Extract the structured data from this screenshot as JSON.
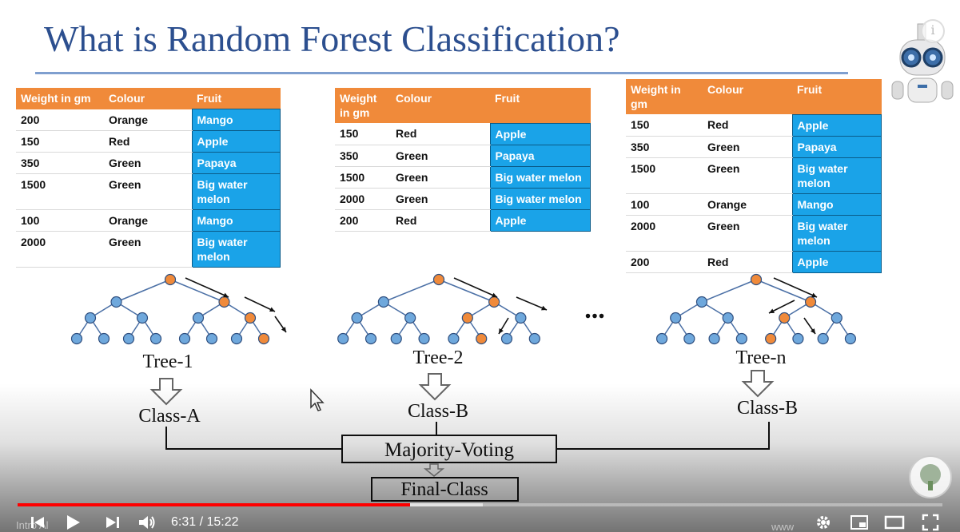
{
  "slide": {
    "title": "What is Random Forest Classification?",
    "tables": [
      {
        "headers": [
          "Weight in gm",
          "Colour",
          "Fruit"
        ],
        "rows": [
          [
            "200",
            "Orange",
            "Mango"
          ],
          [
            "150",
            "Red",
            "Apple"
          ],
          [
            "350",
            "Green",
            "Papaya"
          ],
          [
            "1500",
            "Green",
            "Big water melon"
          ],
          [
            "100",
            "Orange",
            "Mango"
          ],
          [
            "2000",
            "Green",
            "Big water melon"
          ]
        ]
      },
      {
        "headers": [
          "Weight in gm",
          "Colour",
          "Fruit"
        ],
        "rows": [
          [
            "150",
            "Red",
            "Apple"
          ],
          [
            "350",
            "Green",
            "Papaya"
          ],
          [
            "1500",
            "Green",
            "Big water melon"
          ],
          [
            "2000",
            "Green",
            "Big water melon"
          ],
          [
            "200",
            "Red",
            "Apple"
          ]
        ]
      },
      {
        "headers": [
          "Weight in gm",
          "Colour",
          "Fruit"
        ],
        "rows": [
          [
            "150",
            "Red",
            "Apple"
          ],
          [
            "350",
            "Green",
            "Papaya"
          ],
          [
            "1500",
            "Green",
            "Big water melon"
          ],
          [
            "100",
            "Orange",
            "Mango"
          ],
          [
            "2000",
            "Green",
            "Big water melon"
          ],
          [
            "200",
            "Red",
            "Apple"
          ]
        ]
      }
    ],
    "diagram": {
      "trees": [
        {
          "label": "Tree-1",
          "class_label": "Class-A"
        },
        {
          "label": "Tree-2",
          "class_label": "Class-B"
        },
        {
          "label": "Tree-n",
          "class_label": "Class-B"
        }
      ],
      "ellipsis": "...",
      "majority_label": "Majority-Voting",
      "final_label": "Final-Class",
      "colors": {
        "node": "#6fa8dc",
        "path_node": "#f08a3a",
        "edge": "#4a6fa5"
      }
    }
  },
  "player": {
    "current_time": "6:31",
    "separator": " / ",
    "duration": "15:22",
    "played_fraction": 0.424,
    "buffered_fraction": 0.503,
    "progress_color": "#ff0000",
    "icons": [
      "previous-icon",
      "play-icon",
      "next-icon",
      "volume-icon",
      "settings-icon",
      "miniplayer-icon",
      "theater-icon",
      "fullscreen-icon",
      "info-icon"
    ]
  },
  "colors": {
    "title": "#2c4f8f",
    "table_header": "#f08a3a",
    "fruit_cell": "#1aa3e8"
  }
}
